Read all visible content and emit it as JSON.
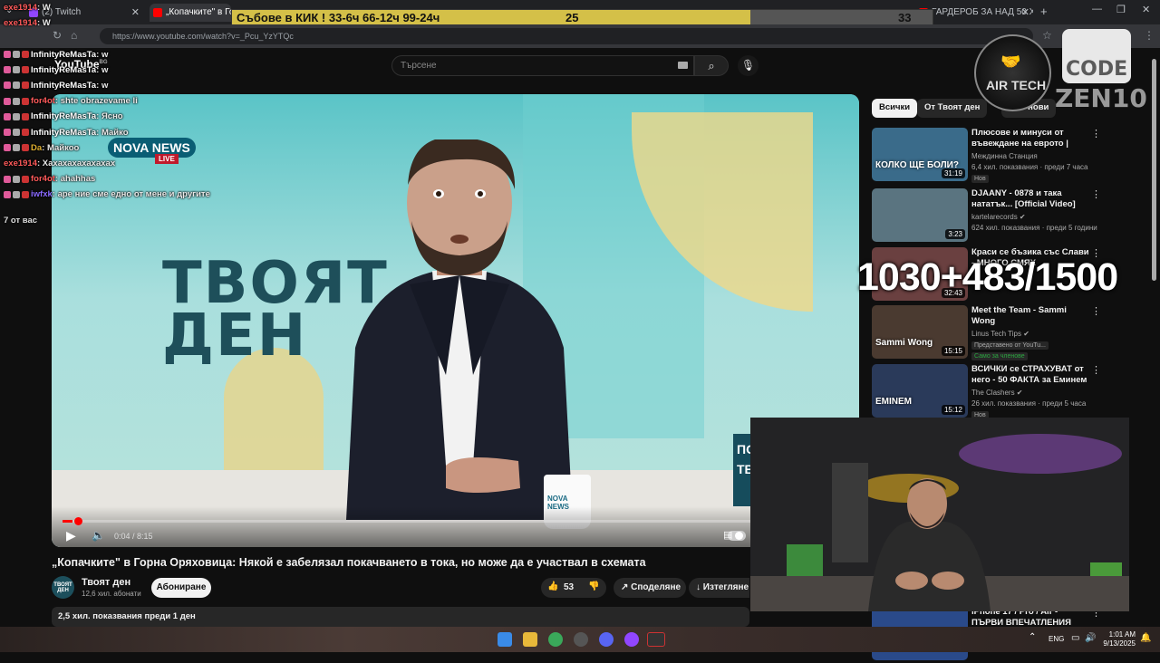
{
  "tabs": [
    {
      "label": "(2) Twitch",
      "color": "#9146ff"
    },
    {
      "label": "„Копачките\" в Горна",
      "color": "#ff0000"
    },
    {
      "label": "ГАРДЕРОБ ЗА НАД 50 ХИЛЯ",
      "color": "#ff0000"
    }
  ],
  "donation_bar": {
    "text": "Събове в КИК ! 33-6ч 66-12ч 99-24ч",
    "current": "25",
    "target": "33",
    "progress": 0.74,
    "fill_color": "#d4c048"
  },
  "address": {
    "url": "https://www.youtube.com/watch?v=_Pcu_YzYTQc"
  },
  "youtube": {
    "logo": "YouTube",
    "logo_country": "BG",
    "search_placeholder": "Търсене"
  },
  "video": {
    "news_badge": "NOVA NEWS",
    "live_badge": "LIVE",
    "set_logo_line1": "ТВОЯТ",
    "set_logo_line2": "ДЕН",
    "mug_text": "NOVA NEWS",
    "bug_text": "ПО ТВ",
    "time": "0:04 / 8:15",
    "progress": 0.008,
    "title": "„Копачките\" в Горна Оряховица: Някой е забелязал покачването в тока, но може да е участвал в схемата",
    "channel": "Твоят ден",
    "channel_avatar": "ТВОЯТ ДЕН",
    "subscribers": "12,6 хил. абонати",
    "subscribe_label": "Абониране",
    "likes": "53",
    "share_label": "Споделяне",
    "download_label": "Изтегляне",
    "views": "2,5 хил. показвания  преди 1 ден"
  },
  "chips": [
    "Всички",
    "От Твоят ден",
    "Най-нови"
  ],
  "recommendations": [
    {
      "title": "Плюсове и минуси от въвеждане на еврото | Иван ...",
      "channel": "Междинна Станция",
      "meta": "6,4 хил. показвания · преди 7 часа",
      "badge": "Нов",
      "duration": "31:19",
      "thumb_color": "#3a6b8a",
      "thumb_text": "КОЛКО ЩЕ БОЛИ?"
    },
    {
      "title": "DJAANY - 0878 и така нататък... [Official Video] (Pro...",
      "channel": "kartelarecords ✔",
      "meta": "624 хил. показвания · преди 5 години",
      "badge": "",
      "duration": "3:23",
      "thumb_color": "#5a7480",
      "thumb_text": ""
    },
    {
      "title": "Краси се бъзика със Слави - МНОГО СМЯХ",
      "channel": "",
      "meta": "",
      "badge": "",
      "duration": "32:43",
      "thumb_color": "#6a4040",
      "thumb_text": ""
    },
    {
      "title": "Meet the Team - Sammi Wong",
      "channel": "Linus Tech Tips ✔",
      "meta": "преди 10 дни",
      "badge": "Представено от YouTu...",
      "badge2": "Само за членове",
      "duration": "15:15",
      "thumb_color": "#4a3a30",
      "thumb_text": "Sammi Wong"
    },
    {
      "title": "ВСИЧКИ се СТРАХУВАТ от него - 50 ФАКТА за Еминем",
      "channel": "The Clashers ✔",
      "meta": "26 хил. показвания · преди 5 часа",
      "badge": "Нов",
      "duration": "15:12",
      "thumb_color": "#2a3a5a",
      "thumb_text": "EMINEM"
    },
    {
      "title": "iPhone 17 / Pro / Air - ПЪРВИ ВПЕЧАТЛЕНИЯ",
      "channel": "",
      "meta": "",
      "badge": "",
      "duration": "",
      "thumb_color": "#2a4a8a",
      "thumb_text": "iPhone 17"
    }
  ],
  "chat": [
    {
      "user": "exe1914",
      "text": "W",
      "user_color": "#ff5a5a"
    },
    {
      "user": "exe1914",
      "text": "W",
      "user_color": "#ff5a5a"
    },
    {
      "user": "",
      "text": "",
      "user_color": "#ffffff"
    },
    {
      "user": "InfinityReMasTa",
      "text": "w",
      "user_color": "#ffffff"
    },
    {
      "user": "InfinityReMasTa",
      "text": "w",
      "user_color": "#ffffff"
    },
    {
      "user": "InfinityReMasTa",
      "text": "w",
      "user_color": "#ffffff"
    },
    {
      "user": "for4ot",
      "text": "shte obrazevame li",
      "user_color": "#ff5a5a"
    },
    {
      "user": "InfinityReMasTa",
      "text": "Ясно",
      "user_color": "#ffffff"
    },
    {
      "user": "InfinityReMasTa",
      "text": "Майко",
      "user_color": "#ffffff"
    },
    {
      "user": "Da",
      "text": "Майкоо",
      "user_color": "#e0b030"
    },
    {
      "user": "exe1914",
      "text": "Хахахахахахахах",
      "user_color": "#ff5a5a"
    },
    {
      "user": "for4ot",
      "text": "ahahhas",
      "user_color": "#ff5a5a"
    },
    {
      "user": "iwfxk",
      "text": "аре ние сме едно от мене и другите",
      "user_color": "#8a6aff"
    }
  ],
  "viewers": "7 от вас",
  "overlay": {
    "airtech": "AIR TECH",
    "code_line1": "CODE",
    "code_line2": "ZEN10",
    "goal": "1030+483/1500"
  },
  "taskbar": {
    "lang": "ENG",
    "time": "1:01 AM",
    "date": "9/13/2025"
  }
}
